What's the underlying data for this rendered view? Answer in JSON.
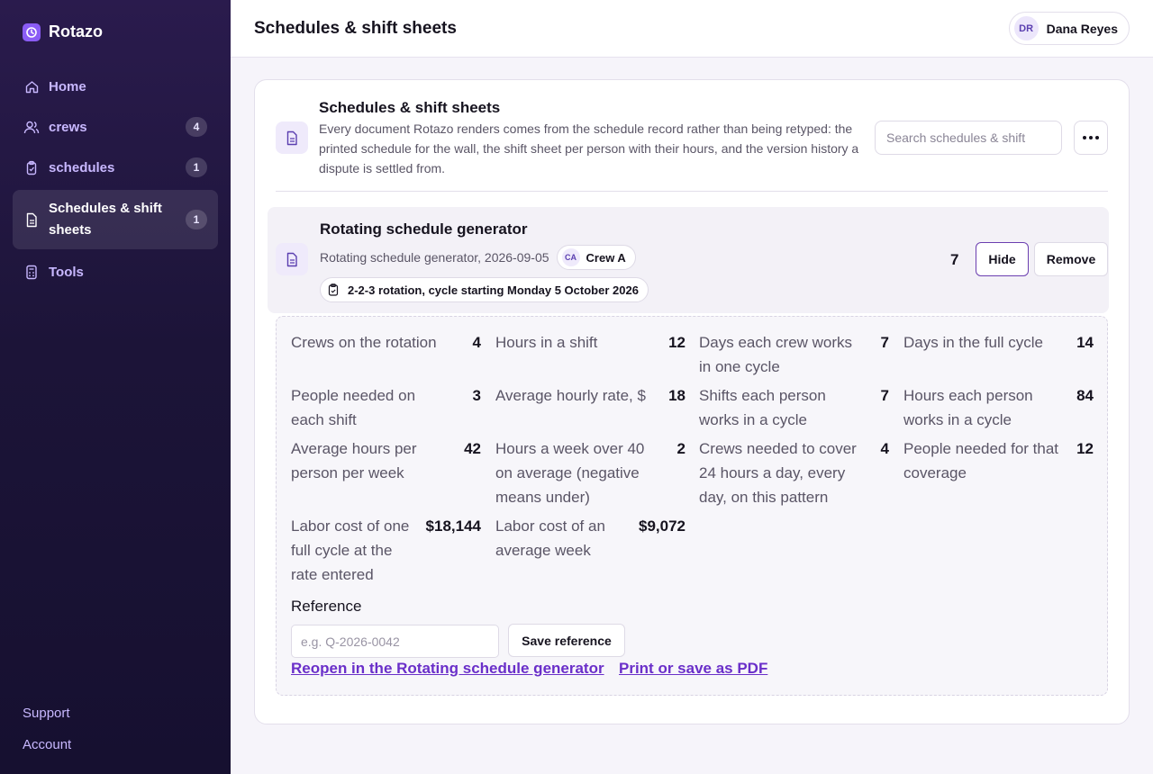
{
  "app": {
    "name": "Rotazo"
  },
  "sidebar": {
    "items": [
      {
        "label": "Home",
        "icon": "home-icon"
      },
      {
        "label": "crews",
        "badge": "4",
        "icon": "users-icon"
      },
      {
        "label": "schedules",
        "badge": "1",
        "icon": "clipboard-icon"
      },
      {
        "label": "Schedules & shift sheets",
        "badge": "1",
        "icon": "document-icon",
        "active": true
      },
      {
        "label": "Tools",
        "icon": "calculator-icon"
      }
    ],
    "footer": {
      "support": "Support",
      "account": "Account"
    }
  },
  "header": {
    "title": "Schedules & shift sheets",
    "user": {
      "initials": "DR",
      "name": "Dana Reyes"
    }
  },
  "section": {
    "title": "Schedules & shift sheets",
    "description": "Every document Rotazo renders comes from the schedule record rather than being retyped: the printed schedule for the wall, the shift sheet per person with their hours, and the version history a dispute is settled from.",
    "search_placeholder": "Search schedules & shift"
  },
  "document": {
    "title": "Rotating schedule generator",
    "subtitle": "Rotating schedule generator, 2026-09-05",
    "crew": {
      "initials": "CA",
      "name": "Crew A"
    },
    "tag": "2-2-3 rotation, cycle starting Monday 5 October 2026",
    "count": "7",
    "hide_label": "Hide",
    "remove_label": "Remove"
  },
  "stats": [
    {
      "label": "Crews on the rotation",
      "value": "4"
    },
    {
      "label": "Hours in a shift",
      "value": "12"
    },
    {
      "label": "Days each crew works in one cycle",
      "value": "7"
    },
    {
      "label": "Days in the full cycle",
      "value": "14"
    },
    {
      "label": "People needed on each shift",
      "value": "3"
    },
    {
      "label": "Average hourly rate, $",
      "value": "18"
    },
    {
      "label": "Shifts each person works in a cycle",
      "value": "7"
    },
    {
      "label": "Hours each person works in a cycle",
      "value": "84"
    },
    {
      "label": "Average hours per person per week",
      "value": "42"
    },
    {
      "label": "Hours a week over 40 on average (negative means under)",
      "value": "2"
    },
    {
      "label": "Crews needed to cover 24 hours a day, every day, on this pattern",
      "value": "4"
    },
    {
      "label": "People needed for that coverage",
      "value": "12"
    },
    {
      "label": "Labor cost of one full cycle at the rate entered",
      "value": "$18,144"
    },
    {
      "label": "Labor cost of an average week",
      "value": "$9,072"
    }
  ],
  "reference": {
    "label": "Reference",
    "placeholder": "e.g. Q-2026-0042",
    "save_label": "Save reference"
  },
  "links": {
    "reopen": "Reopen in the Rotating schedule generator",
    "print": "Print or save as PDF"
  },
  "colors": {
    "accent": "#6a2fc9",
    "sidebar": "#1c1438",
    "brand": "#8a5cf5"
  }
}
